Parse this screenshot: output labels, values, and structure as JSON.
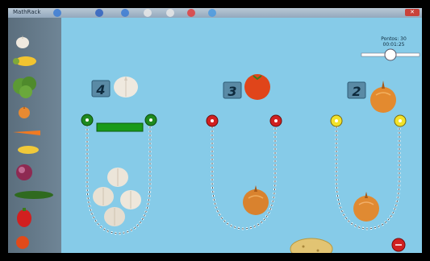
{
  "window": {
    "title": "MathRack"
  },
  "header": {
    "score_label": "Pontos: 30",
    "timer": "00:01:25"
  },
  "slider": {
    "value": 0.5
  },
  "sidebar": {
    "items": [
      "garlic-icon",
      "corn-icon",
      "broccoli-icon",
      "onion-icon",
      "carrot-icon",
      "corn-icon",
      "red-onion-icon",
      "cucumber-icon",
      "pepper-icon",
      "tomato-icon"
    ]
  },
  "targets": [
    {
      "number": "4",
      "item": "garlic",
      "pin_color": "#1f8a1f",
      "contained": 4
    },
    {
      "number": "3",
      "item": "tomato",
      "pin_color": "#d12020",
      "contained": 1
    },
    {
      "number": "2",
      "item": "onion",
      "pin_color": "#f2e22a",
      "contained": 1
    }
  ],
  "progress_bar": {
    "color": "#1a9a1a"
  },
  "colors": {
    "board": "#86cbe8",
    "stop_button": "#d02020"
  }
}
